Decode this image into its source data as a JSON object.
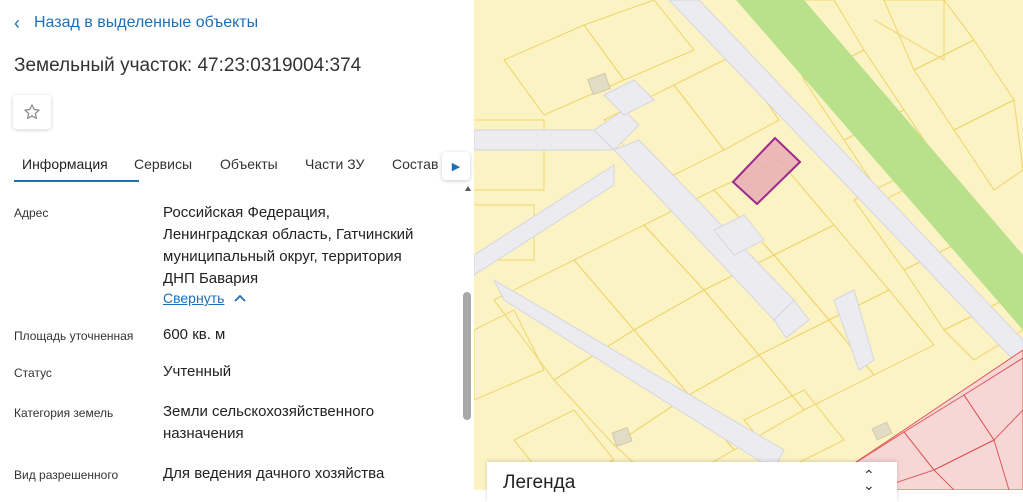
{
  "nav": {
    "back_label": "Назад в выделенные объекты"
  },
  "object": {
    "title": "Земельный участок: 47:23:0319004:374"
  },
  "tabs": [
    {
      "label": "Информация",
      "active": true
    },
    {
      "label": "Сервисы"
    },
    {
      "label": "Объекты"
    },
    {
      "label": "Части ЗУ"
    },
    {
      "label": "Состав"
    }
  ],
  "info": {
    "address": {
      "label": "Адрес",
      "lines": [
        "Российская Федерация,",
        "Ленинградская область, Гатчинский",
        "муниципальный округ, территория",
        "ДНП Бавария"
      ],
      "collapse_label": "Свернуть"
    },
    "area": {
      "label": "Площадь уточненная",
      "value": "600 кв. м"
    },
    "status": {
      "label": "Статус",
      "value": "Учтенный"
    },
    "category": {
      "label": "Категория земель",
      "lines": [
        "Земли сельскохозяйственного",
        "назначения"
      ]
    },
    "permitted_use": {
      "label": "Вид разрешенного",
      "value": "Для ведения дачного хозяйства"
    }
  },
  "legend": {
    "label": "Легенда"
  },
  "colors": {
    "accent": "#1f6fb5",
    "map_background": "#fbf3c4",
    "parcel_outline": "#f0d46a",
    "road": "#ebebf0",
    "green_strip": "#b9e08a",
    "selected_outline": "#9b2a8c",
    "selected_fill": "#e8a9b4",
    "red_zone": "#e05a5a"
  },
  "icons": {
    "back": "chevron-left-icon",
    "favorite": "star-outline-icon",
    "tabs_next": "triangle-right-icon",
    "collapse": "chevron-up-icon",
    "legend_toggle": "chevron-up-down-icon"
  }
}
